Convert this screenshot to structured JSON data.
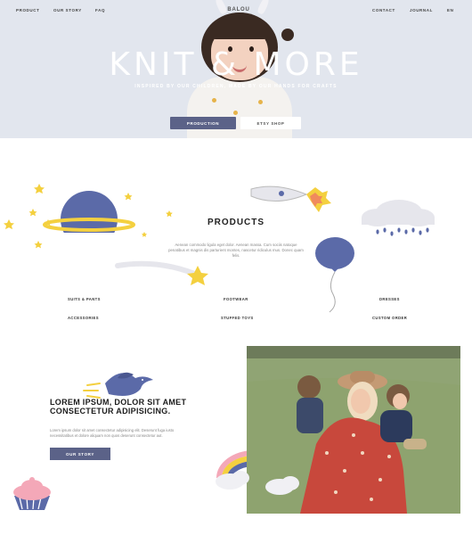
{
  "nav": {
    "left": [
      "PRODUCT",
      "OUR STORY",
      "FAQ"
    ],
    "right": [
      "CONTACT",
      "JOURNAL",
      "EN"
    ],
    "logo": "BALOU"
  },
  "hero": {
    "title": "KNIT & MORE",
    "subtitle": "INSPIRED BY OUR CHILDREN, MADE BY OUR HANDS FOR CRAFTS",
    "btn_production": "PRODUCTION",
    "btn_shop": "ETSY SHOP"
  },
  "products": {
    "title": "PRODUCTS",
    "text": "Aenean commodo ligula eget dolor. Aenean massa. Cum sociis natoque penatibus et magnis dis parturient montes, nascetur ridiculus mus. Donec quam felis.",
    "categories": [
      "SUITS & PANTS",
      "FOOTWEAR",
      "DRESSES",
      "ACCESSORIES",
      "STUFFED TOYS",
      "CUSTOM ORDER"
    ]
  },
  "story": {
    "heading": "LOREM IPSUM, DOLOR SIT AMET CONSECTETUR ADIPISICING.",
    "text": "Lorem ipsum dolor sit amet consectetur adipisicing elit. Deserunt fuga iusto necessitatibus et dolore aliquam non quos deserunt consectetur aut.",
    "button": "OUR STORY"
  },
  "colors": {
    "accent": "#5b6288",
    "hero_bg": "#e2e6ee",
    "star": "#f4d03f"
  }
}
